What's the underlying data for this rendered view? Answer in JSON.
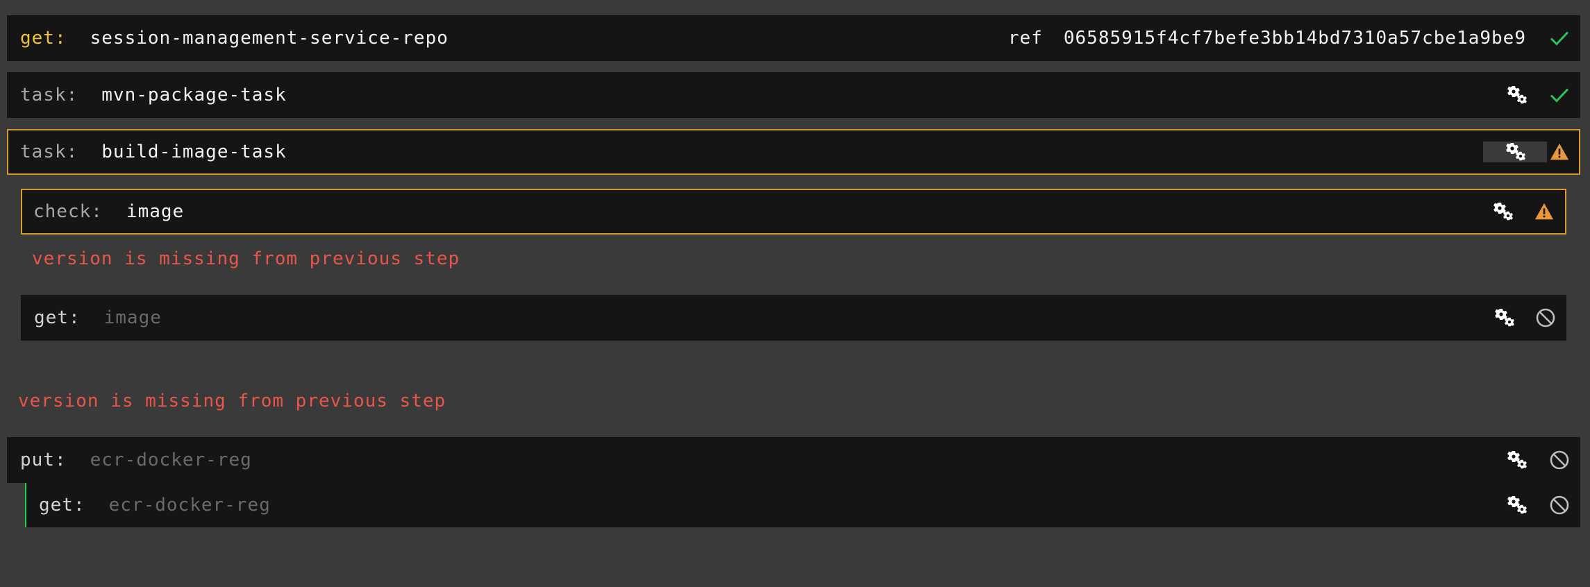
{
  "steps": {
    "get_repo": {
      "keyword": "get:",
      "name": "session-management-service-repo",
      "ref_label": "ref",
      "ref_value": "06585915f4cf7befe3bb14bd7310a57cbe1a9be9",
      "status": "succeeded"
    },
    "mvn_task": {
      "keyword": "task:",
      "name": "mvn-package-task",
      "status": "succeeded"
    },
    "build_task": {
      "keyword": "task:",
      "name": "build-image-task",
      "status": "errored"
    },
    "check_image": {
      "keyword": "check:",
      "name": "image",
      "status": "errored"
    },
    "check_error": "version is missing from previous step",
    "get_image": {
      "keyword": "get:",
      "name": "image",
      "status": "aborted"
    },
    "build_error": "version is missing from previous step",
    "put_ecr": {
      "keyword": "put:",
      "name": "ecr-docker-reg",
      "status": "aborted"
    },
    "get_ecr": {
      "keyword": "get:",
      "name": "ecr-docker-reg",
      "status": "aborted"
    }
  },
  "colors": {
    "background": "#3a3a3a",
    "step_background": "#151515",
    "get_keyword": "#f0c23a",
    "succeeded": "#32c25c",
    "errored": "#e8983a",
    "error_text": "#e8564a",
    "nested_line": "#1fd34f"
  },
  "icons": {
    "succeeded": "check-icon",
    "errored": "warning-icon",
    "aborted": "no-icon",
    "metadata": "gears-icon"
  }
}
